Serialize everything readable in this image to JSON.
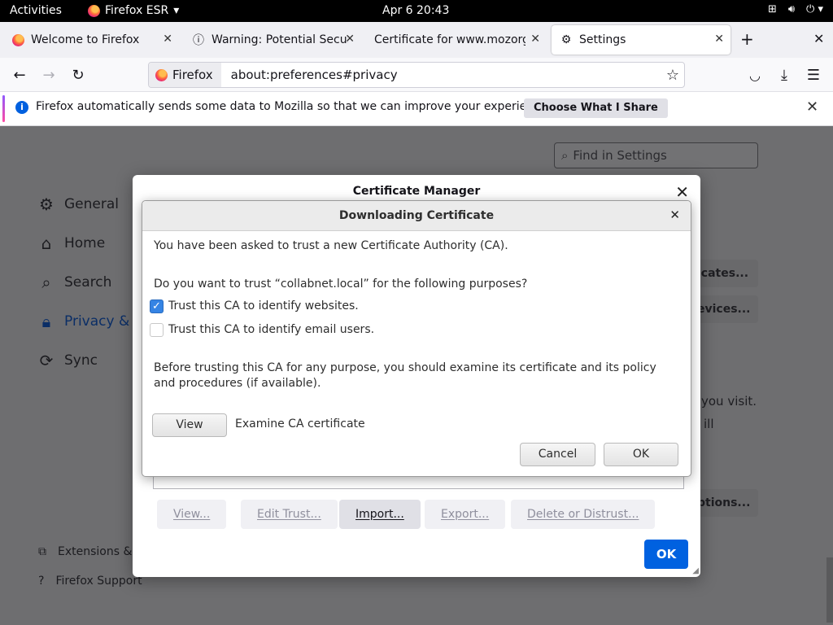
{
  "topbar": {
    "activities": "Activities",
    "app_name": "Firefox ESR",
    "clock": "Apr 6  20:43"
  },
  "tabs": [
    {
      "title": "Welcome to Firefox",
      "icon": "firefox-icon",
      "active": false
    },
    {
      "title": "Warning: Potential Security Risk Ahead",
      "icon": "warning-info-icon",
      "active": false
    },
    {
      "title": "Certificate for www.mozorg.example",
      "icon": "none",
      "active": false
    },
    {
      "title": "Settings",
      "icon": "gear-icon",
      "active": true
    }
  ],
  "navbar": {
    "identity_label": "Firefox",
    "url": "about:preferences#privacy"
  },
  "notification": {
    "text": "Firefox automatically sends some data to Mozilla so that we can improve your experience.",
    "button": "Choose What I Share"
  },
  "settings": {
    "search_placeholder": "Find in Settings",
    "categories": [
      {
        "label": "General",
        "icon": "gear-icon"
      },
      {
        "label": "Home",
        "icon": "home-icon"
      },
      {
        "label": "Search",
        "icon": "search-icon"
      },
      {
        "label": "Privacy & S",
        "icon": "lock-icon",
        "selected": true
      },
      {
        "label": "Sync",
        "icon": "sync-icon"
      }
    ],
    "footer_links": [
      {
        "label": "Extensions &",
        "icon": "puzzle-icon"
      },
      {
        "label": "Firefox Support",
        "icon": "help-icon"
      }
    ],
    "background_buttons": [
      "icates...",
      "evices...",
      "ptions..."
    ],
    "background_texts": [
      "you visit.",
      "ill"
    ]
  },
  "cert_manager": {
    "title": "Certificate Manager",
    "buttons": {
      "view": "View...",
      "edit_trust": "Edit Trust...",
      "import": "Import...",
      "export": "Export...",
      "delete": "Delete or Distrust..."
    },
    "ok": "OK"
  },
  "download_dialog": {
    "title": "Downloading Certificate",
    "intro": "You have been asked to trust a new Certificate Authority (CA).",
    "question": "Do you want to trust “collabnet.local” for the following purposes?",
    "options": [
      {
        "label": "Trust this CA to identify websites.",
        "checked": true
      },
      {
        "label": "Trust this CA to identify email users.",
        "checked": false
      }
    ],
    "advice": "Before trusting this CA for any purpose, you should examine its certificate and its policy and procedures (if available).",
    "view_button": "View",
    "view_label": "Examine CA certificate",
    "cancel": "Cancel",
    "ok": "OK"
  },
  "colors": {
    "accent": "#0061e0",
    "checkbox": "#3584e4",
    "topbar": "#000000"
  }
}
